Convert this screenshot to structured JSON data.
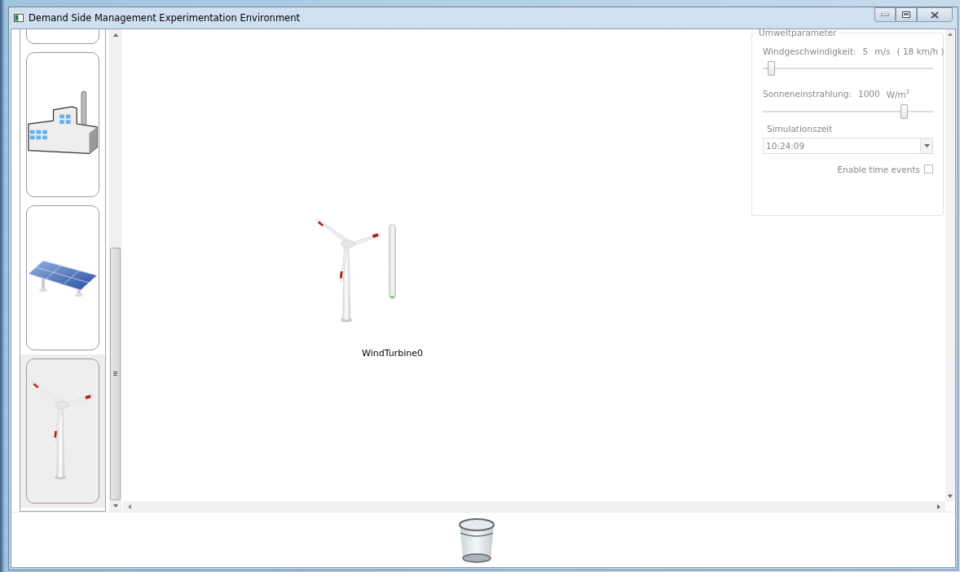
{
  "window": {
    "title": "Demand Side Management Experimentation Environment"
  },
  "palette": {
    "items": [
      {
        "kind": "hidden",
        "selected": false
      },
      {
        "kind": "factory",
        "selected": false
      },
      {
        "kind": "solar",
        "selected": false
      },
      {
        "kind": "wind",
        "selected": true
      }
    ]
  },
  "canvas": {
    "nodes": [
      {
        "kind": "wind",
        "label": "WindTurbine0",
        "level": 0.03
      }
    ]
  },
  "environment": {
    "title": "Umweltparameter",
    "sliders": [
      {
        "label": "Windgeschwindigkeit:",
        "value": "5",
        "unit": "m/s",
        "extra": "( 18 km/h )",
        "level": 0.05
      },
      {
        "label": "Sonneneinstrahlung:",
        "value": "1000",
        "unit": "W/m$^{2}$",
        "level": 0.83
      }
    ],
    "time": {
      "label": "Simulationszeit",
      "value": "10:24:09"
    },
    "time_events": {
      "label": "Enable time events",
      "checked": false
    }
  }
}
